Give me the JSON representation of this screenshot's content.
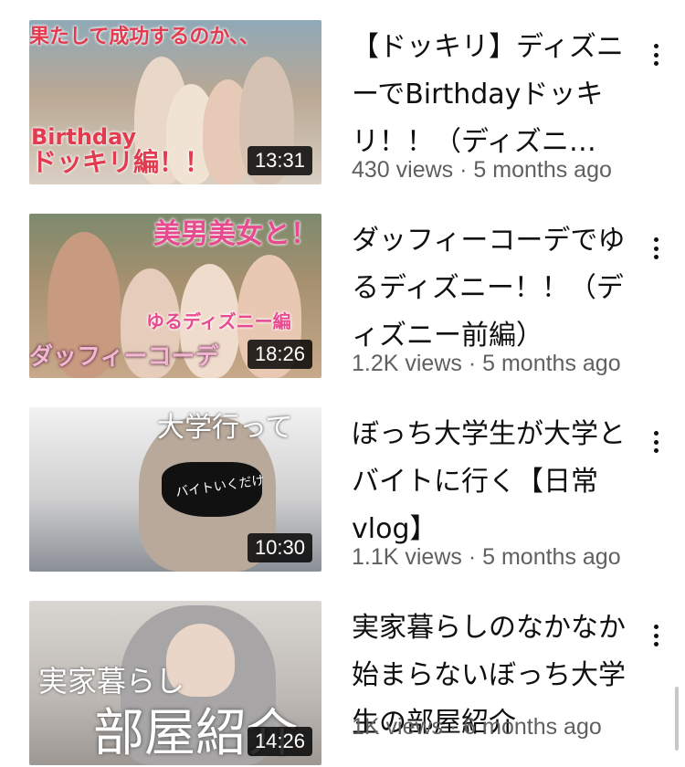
{
  "videos": [
    {
      "title": "【ドッキリ】ディズニーでBirthdayドッキリ！！（ディズニ…",
      "views": "430 views",
      "age": "5 months ago",
      "duration": "13:31",
      "thumb_text": [
        "果たして成功するのか、、",
        "Birthday",
        "ドッキリ編！！"
      ],
      "accent": "#e83a5a"
    },
    {
      "title": "ダッフィーコーデでゆるディズニー！！（ディズニー前編）",
      "views": "1.2K views",
      "age": "5 months ago",
      "duration": "18:26",
      "thumb_text": [
        "美男美女と！",
        "ゆるディズニー編",
        "ダッフィーコーデ"
      ],
      "accent": "#e8509a"
    },
    {
      "title": "ぼっち大学生が大学とバイトに行く【日常vlog】",
      "views": "1.1K views",
      "age": "5 months ago",
      "duration": "10:30",
      "thumb_text": [
        "大学行って",
        "バイトいくだけ"
      ],
      "accent": "#ffffff"
    },
    {
      "title": "実家暮らしのなかなか始まらないぼっち大学生の部屋紹介",
      "views": "1K views",
      "age": "6 months ago",
      "duration": "14:26",
      "thumb_text": [
        "実家暮らし",
        "部屋紹介"
      ],
      "accent": "#ffffff"
    }
  ],
  "separator": "·"
}
